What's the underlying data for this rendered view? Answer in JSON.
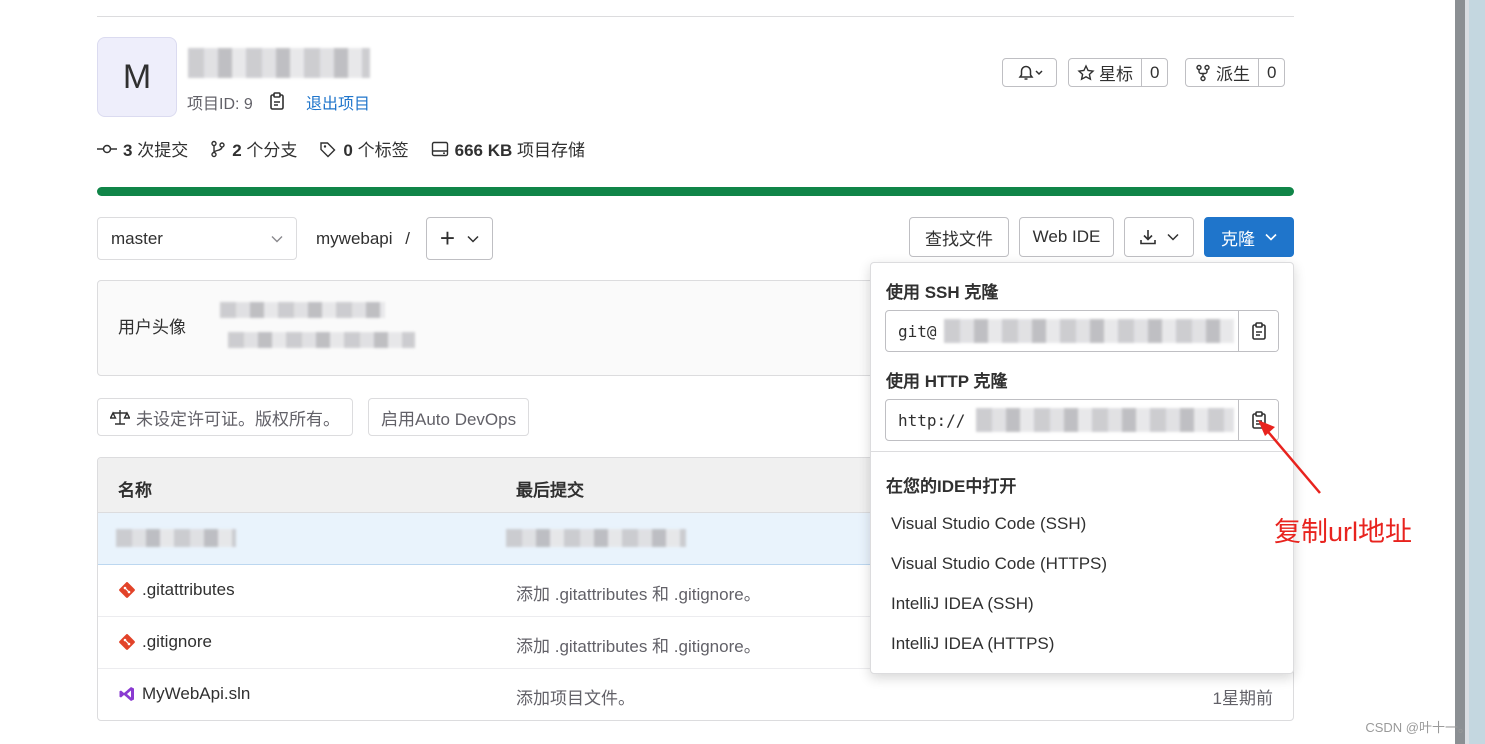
{
  "project": {
    "avatar_letter": "M",
    "id_text": "项目ID: 9",
    "leave_label": "退出项目"
  },
  "header_actions": {
    "star_label": "星标",
    "star_count": "0",
    "fork_label": "派生",
    "fork_count": "0"
  },
  "stats": {
    "commits_num": "3",
    "commits_label": "次提交",
    "branches_num": "2",
    "branches_label": "个分支",
    "tags_num": "0",
    "tags_label": "个标签",
    "storage_num": "666 KB",
    "storage_label": "项目存储"
  },
  "pipeline": {
    "progress": 1.0,
    "color": "#108548"
  },
  "toolbar": {
    "branch": "master",
    "breadcrumb": "mywebapi",
    "breadcrumb_sep": "/",
    "plus": "+",
    "find_file": "查找文件",
    "web_ide": "Web IDE",
    "clone": "克隆"
  },
  "last_commit": {
    "avatar_alt": "用户头像"
  },
  "badges": {
    "license": "未设定许可证。版权所有。",
    "devops": "启用Auto DevOps"
  },
  "files": {
    "col_name": "名称",
    "col_commit": "最后提交",
    "rows": [
      {
        "name": ".gitattributes",
        "commit": "添加 .gitattributes 和 .gitignore。",
        "time": ""
      },
      {
        "name": ".gitignore",
        "commit": "添加 .gitattributes 和 .gitignore。",
        "time": ""
      },
      {
        "name": "MyWebApi.sln",
        "commit": "添加项目文件。",
        "time": "1星期前"
      }
    ]
  },
  "clone_menu": {
    "ssh_header": "使用 SSH 克隆",
    "ssh_url": "git@",
    "http_header": "使用 HTTP 克隆",
    "http_url": "http://",
    "ide_header": "在您的IDE中打开",
    "ide_items": [
      "Visual Studio Code (SSH)",
      "Visual Studio Code (HTTPS)",
      "IntelliJ IDEA (SSH)",
      "IntelliJ IDEA (HTTPS)"
    ]
  },
  "annotation": {
    "text": "复制url地址",
    "color": "#e8231e"
  },
  "watermark": "CSDN @叶十一。",
  "colors": {
    "accent": "#1f75cb",
    "success": "#108548"
  }
}
